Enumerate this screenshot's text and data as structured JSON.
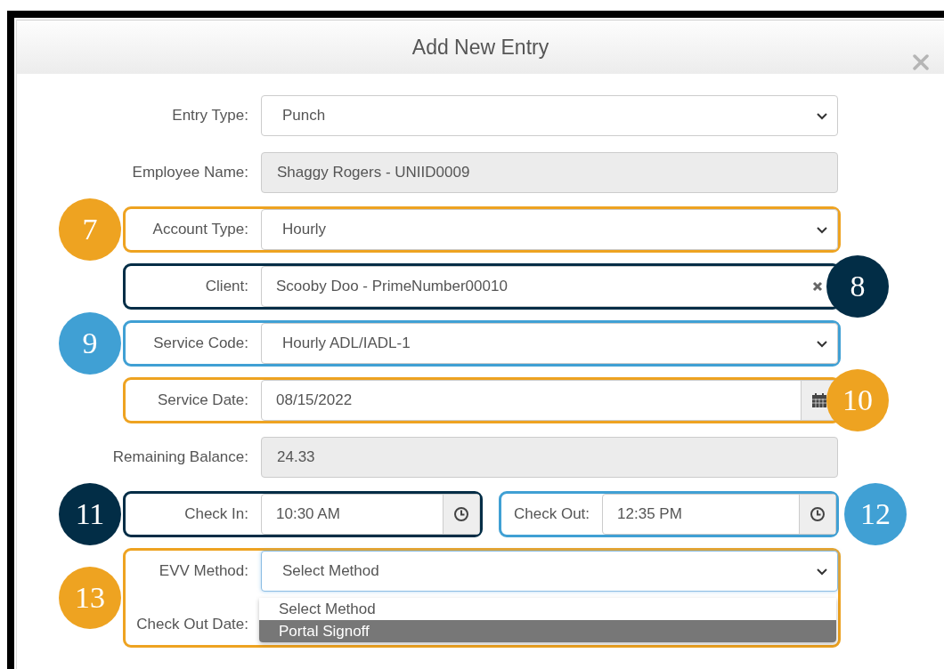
{
  "dialog": {
    "title": "Add New Entry"
  },
  "rows": [
    {
      "kind": "select",
      "label": "Entry Type:",
      "value": "Punch"
    },
    {
      "kind": "readonly",
      "label": "Employee Name:",
      "value": "Shaggy Rogers - UNIID0009"
    },
    {
      "kind": "select",
      "label": "Account Type:",
      "value": "Hourly",
      "callout": {
        "number": "7",
        "color": "#eea321",
        "on_right": false
      }
    },
    {
      "kind": "clearable",
      "label": "Client:",
      "value": "Scooby Doo - PrimeNumber00010",
      "callout": {
        "number": "8",
        "color": "#022d46",
        "on_right": true
      }
    },
    {
      "kind": "select",
      "label": "Service Code:",
      "value": "Hourly ADL/IADL-1",
      "callout": {
        "number": "9",
        "color": "#40a0d4",
        "on_right": false
      }
    },
    {
      "kind": "date",
      "label": "Service Date:",
      "value": "08/15/2022",
      "callout": {
        "number": "10",
        "color": "#eea321",
        "on_right": true
      }
    },
    {
      "kind": "readonly",
      "label": "Remaining Balance:",
      "value": "24.33"
    },
    {
      "kind": "time_pair",
      "items": [
        {
          "label": "Check In:",
          "value": "10:30 AM",
          "callout": {
            "number": "11",
            "color": "#022d46",
            "on_right": false
          }
        },
        {
          "label": "Check Out:",
          "value": "12:35 PM",
          "callout": {
            "number": "12",
            "color": "#40a0d4",
            "on_right": true
          }
        }
      ]
    },
    {
      "kind": "open_select",
      "label": "EVV Method:",
      "value": "Select Method",
      "focused": true,
      "next_label": "Check Out Date:",
      "options": [
        {
          "label": "Select Method",
          "highlighted": false
        },
        {
          "label": "Portal Signoff",
          "highlighted": true
        }
      ],
      "callout": {
        "number": "13",
        "color": "#eea321",
        "on_right": false
      }
    }
  ]
}
